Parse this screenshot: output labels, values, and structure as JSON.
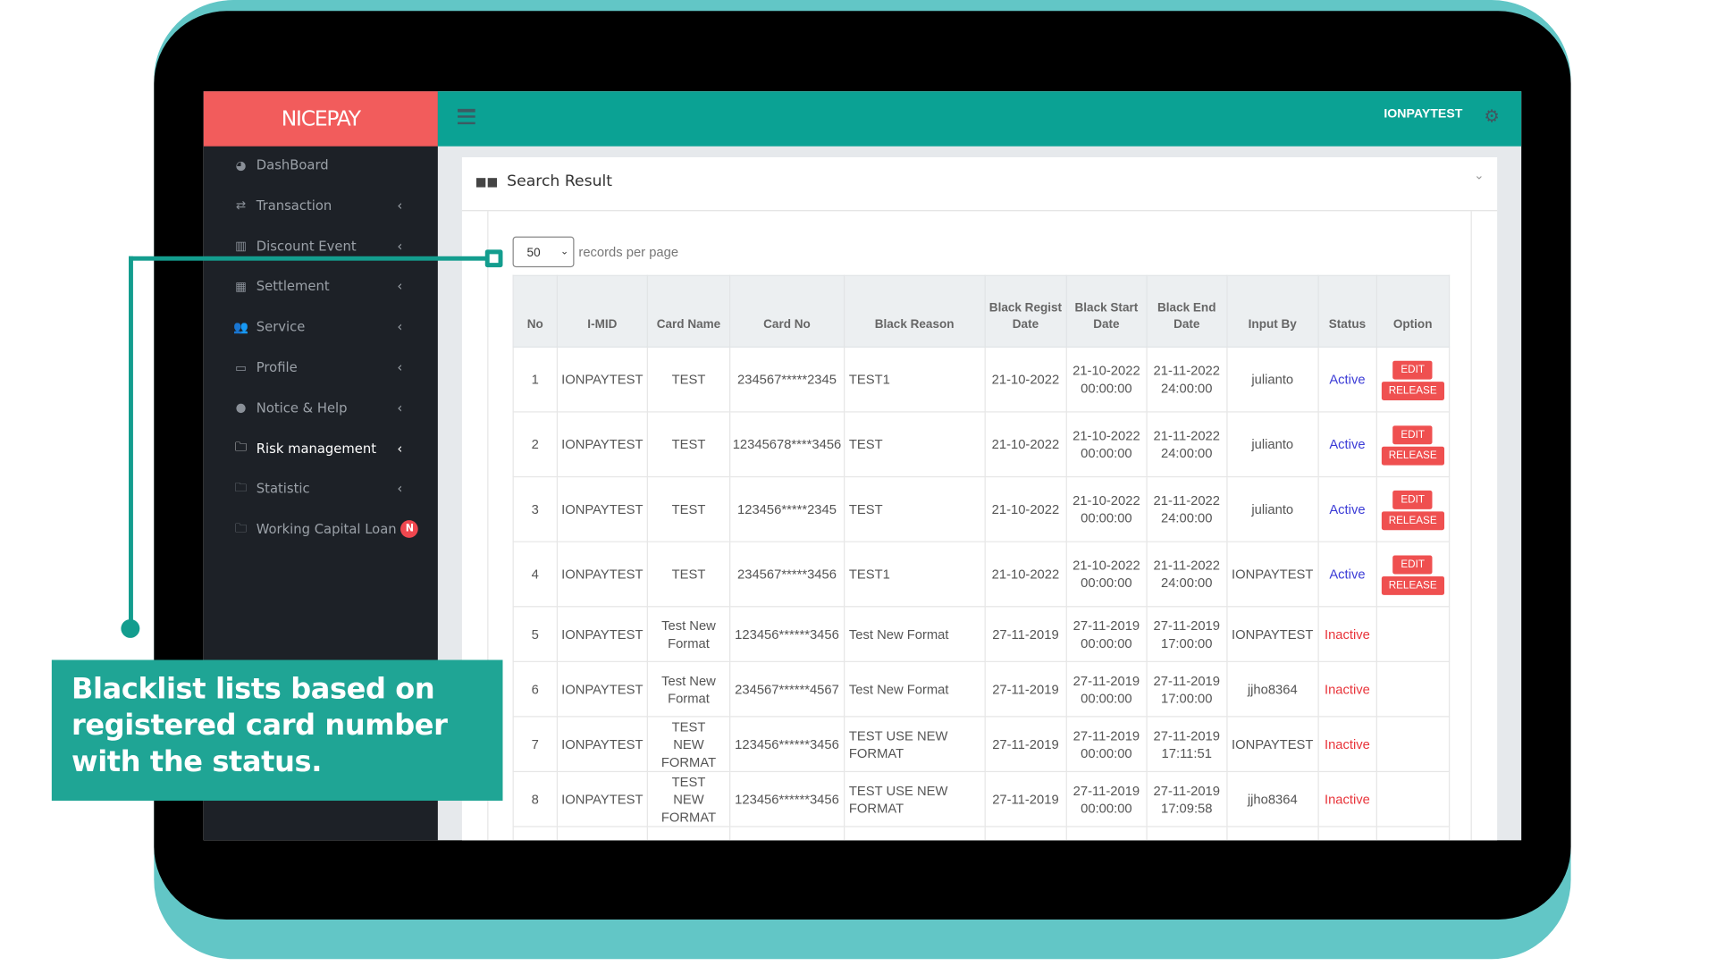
{
  "brand": {
    "logo": "NICEPAY",
    "accent": "#f25c5c",
    "header_color": "#0ba294"
  },
  "header": {
    "user": "IONPAYTEST",
    "settings_icon": "gear-icon",
    "menu_icon": "hamburger-icon"
  },
  "sidebar": {
    "items": [
      {
        "label": "DashBoard",
        "icon": "dashboard-icon",
        "chevron": false
      },
      {
        "label": "Transaction",
        "icon": "exchange-icon",
        "chevron": true
      },
      {
        "label": "Discount Event",
        "icon": "bar-chart-icon",
        "chevron": true
      },
      {
        "label": "Settlement",
        "icon": "calendar-icon",
        "chevron": true
      },
      {
        "label": "Service",
        "icon": "users-icon",
        "chevron": true
      },
      {
        "label": "Profile",
        "icon": "monitor-icon",
        "chevron": true
      },
      {
        "label": "Notice & Help",
        "icon": "comment-icon",
        "chevron": true
      },
      {
        "label": "Risk management",
        "icon": "folder-icon",
        "chevron": true,
        "active": true
      },
      {
        "label": "Statistic",
        "icon": "folder-icon",
        "chevron": true
      },
      {
        "label": "Working Capital Loan",
        "icon": "folder-icon",
        "badge": "N"
      }
    ]
  },
  "panel": {
    "title": "Search Result",
    "page_size": "50",
    "page_size_label": "records per page"
  },
  "table": {
    "columns": [
      "No",
      "I-MID",
      "Card Name",
      "Card No",
      "Black Reason",
      "Black Regist Date",
      "Black Start Date",
      "Black End Date",
      "Input By",
      "Status",
      "Option"
    ],
    "edit_label": "EDIT",
    "release_label": "RELEASE",
    "rows": [
      {
        "no": "1",
        "imid": "IONPAYTEST",
        "card_name": "TEST",
        "card_no": "234567*****2345",
        "reason": "TEST1",
        "regist": "21-10-2022",
        "start": "21-10-2022 00:00:00",
        "end": "21-11-2022 24:00:00",
        "input_by": "julianto",
        "status": "Active"
      },
      {
        "no": "2",
        "imid": "IONPAYTEST",
        "card_name": "TEST",
        "card_no": "12345678****3456",
        "reason": "TEST",
        "regist": "21-10-2022",
        "start": "21-10-2022 00:00:00",
        "end": "21-11-2022 24:00:00",
        "input_by": "julianto",
        "status": "Active"
      },
      {
        "no": "3",
        "imid": "IONPAYTEST",
        "card_name": "TEST",
        "card_no": "123456*****2345",
        "reason": "TEST",
        "regist": "21-10-2022",
        "start": "21-10-2022 00:00:00",
        "end": "21-11-2022 24:00:00",
        "input_by": "julianto",
        "status": "Active"
      },
      {
        "no": "4",
        "imid": "IONPAYTEST",
        "card_name": "TEST",
        "card_no": "234567*****3456",
        "reason": "TEST1",
        "regist": "21-10-2022",
        "start": "21-10-2022 00:00:00",
        "end": "21-11-2022 24:00:00",
        "input_by": "IONPAYTEST",
        "status": "Active"
      },
      {
        "no": "5",
        "imid": "IONPAYTEST",
        "card_name": "Test New Format",
        "card_no": "123456******3456",
        "reason": "Test New Format",
        "regist": "27-11-2019",
        "start": "27-11-2019 00:00:00",
        "end": "27-11-2019 17:00:00",
        "input_by": "IONPAYTEST",
        "status": "Inactive"
      },
      {
        "no": "6",
        "imid": "IONPAYTEST",
        "card_name": "Test New Format",
        "card_no": "234567******4567",
        "reason": "Test New Format",
        "regist": "27-11-2019",
        "start": "27-11-2019 00:00:00",
        "end": "27-11-2019 17:00:00",
        "input_by": "jjho8364",
        "status": "Inactive"
      },
      {
        "no": "7",
        "imid": "IONPAYTEST",
        "card_name": "TEST NEW FORMAT",
        "card_no": "123456******3456",
        "reason": "TEST USE NEW FORMAT",
        "regist": "27-11-2019",
        "start": "27-11-2019 00:00:00",
        "end": "27-11-2019 17:11:51",
        "input_by": "IONPAYTEST",
        "status": "Inactive"
      },
      {
        "no": "8",
        "imid": "IONPAYTEST",
        "card_name": "TEST NEW FORMAT",
        "card_no": "123456******3456",
        "reason": "TEST USE NEW FORMAT",
        "regist": "27-11-2019",
        "start": "27-11-2019 00:00:00",
        "end": "27-11-2019 17:09:58",
        "input_by": "jjho8364",
        "status": "Inactive"
      }
    ]
  },
  "status_colors": {
    "Active": "#3b3bd6",
    "Inactive": "#e8343a"
  },
  "callout": {
    "text": "Blacklist lists based on registered card number with the status.",
    "color": "#1fa595"
  }
}
